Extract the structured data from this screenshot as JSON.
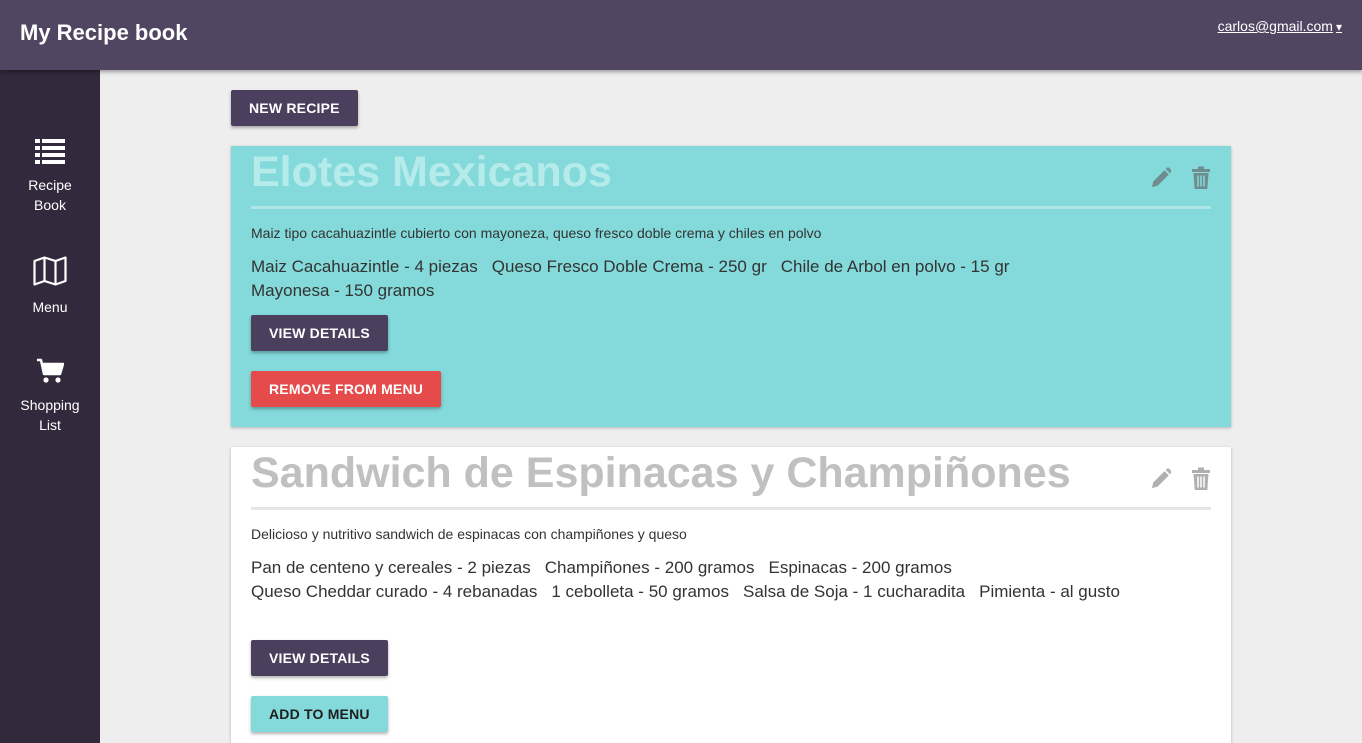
{
  "header": {
    "title": "My Recipe book",
    "user_email": "carlos@gmail.com",
    "user_caret": "▾"
  },
  "sidebar": {
    "items": [
      {
        "label_line1": "Recipe",
        "label_line2": "Book",
        "icon": "list-icon"
      },
      {
        "label_line1": "Menu",
        "label_line2": "",
        "icon": "map-icon"
      },
      {
        "label_line1": "Shopping",
        "label_line2": "List",
        "icon": "cart-icon"
      }
    ]
  },
  "main": {
    "new_recipe_label": "NEW RECIPE"
  },
  "recipes": [
    {
      "title": "Elotes Mexicanos",
      "description": "Maiz tipo cacahuazintle cubierto con mayoneza, queso fresco doble crema y chiles en polvo",
      "ingredients": [
        "Maiz Cacahuazintle - 4 piezas",
        "Queso Fresco Doble Crema - 250 gr",
        "Chile de Arbol en polvo - 15 gr",
        "Mayonesa - 150 gramos"
      ],
      "view_details_label": "VIEW DETAILS",
      "menu_action_label": "REMOVE FROM MENU",
      "in_menu": true
    },
    {
      "title": "Sandwich de Espinacas y Champiñones",
      "description": "Delicioso y nutritivo sandwich de espinacas con champiñones y queso",
      "ingredients": [
        "Pan de centeno y cereales - 2 piezas",
        "Champiñones - 200 gramos",
        "Espinacas - 200 gramos",
        "Queso Cheddar curado - 4 rebanadas",
        "1 cebolleta - 50 gramos",
        "Salsa de Soja - 1 cucharadita",
        "Pimienta - al gusto"
      ],
      "view_details_label": "VIEW DETAILS",
      "menu_action_label": "ADD TO MENU",
      "in_menu": false
    }
  ],
  "colors": {
    "header_bg": "#504662",
    "sidebar_bg": "#322a3c",
    "accent_teal": "#84d9da",
    "button_dark": "#4a3f5c",
    "button_red": "#e64b4b"
  }
}
